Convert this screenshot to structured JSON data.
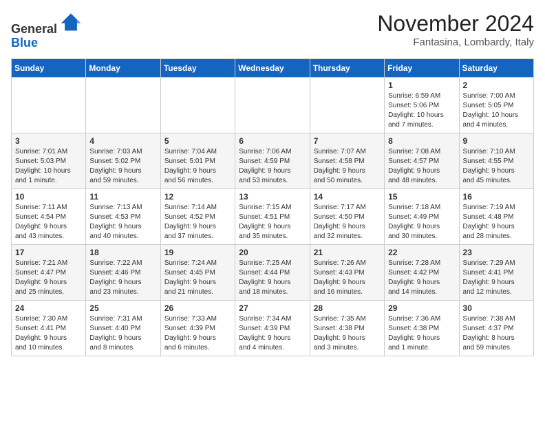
{
  "header": {
    "logo_line1": "General",
    "logo_line2": "Blue",
    "month": "November 2024",
    "location": "Fantasina, Lombardy, Italy"
  },
  "weekdays": [
    "Sunday",
    "Monday",
    "Tuesday",
    "Wednesday",
    "Thursday",
    "Friday",
    "Saturday"
  ],
  "weeks": [
    [
      {
        "day": "",
        "info": ""
      },
      {
        "day": "",
        "info": ""
      },
      {
        "day": "",
        "info": ""
      },
      {
        "day": "",
        "info": ""
      },
      {
        "day": "",
        "info": ""
      },
      {
        "day": "1",
        "info": "Sunrise: 6:59 AM\nSunset: 5:06 PM\nDaylight: 10 hours\nand 7 minutes."
      },
      {
        "day": "2",
        "info": "Sunrise: 7:00 AM\nSunset: 5:05 PM\nDaylight: 10 hours\nand 4 minutes."
      }
    ],
    [
      {
        "day": "3",
        "info": "Sunrise: 7:01 AM\nSunset: 5:03 PM\nDaylight: 10 hours\nand 1 minute."
      },
      {
        "day": "4",
        "info": "Sunrise: 7:03 AM\nSunset: 5:02 PM\nDaylight: 9 hours\nand 59 minutes."
      },
      {
        "day": "5",
        "info": "Sunrise: 7:04 AM\nSunset: 5:01 PM\nDaylight: 9 hours\nand 56 minutes."
      },
      {
        "day": "6",
        "info": "Sunrise: 7:06 AM\nSunset: 4:59 PM\nDaylight: 9 hours\nand 53 minutes."
      },
      {
        "day": "7",
        "info": "Sunrise: 7:07 AM\nSunset: 4:58 PM\nDaylight: 9 hours\nand 50 minutes."
      },
      {
        "day": "8",
        "info": "Sunrise: 7:08 AM\nSunset: 4:57 PM\nDaylight: 9 hours\nand 48 minutes."
      },
      {
        "day": "9",
        "info": "Sunrise: 7:10 AM\nSunset: 4:55 PM\nDaylight: 9 hours\nand 45 minutes."
      }
    ],
    [
      {
        "day": "10",
        "info": "Sunrise: 7:11 AM\nSunset: 4:54 PM\nDaylight: 9 hours\nand 43 minutes."
      },
      {
        "day": "11",
        "info": "Sunrise: 7:13 AM\nSunset: 4:53 PM\nDaylight: 9 hours\nand 40 minutes."
      },
      {
        "day": "12",
        "info": "Sunrise: 7:14 AM\nSunset: 4:52 PM\nDaylight: 9 hours\nand 37 minutes."
      },
      {
        "day": "13",
        "info": "Sunrise: 7:15 AM\nSunset: 4:51 PM\nDaylight: 9 hours\nand 35 minutes."
      },
      {
        "day": "14",
        "info": "Sunrise: 7:17 AM\nSunset: 4:50 PM\nDaylight: 9 hours\nand 32 minutes."
      },
      {
        "day": "15",
        "info": "Sunrise: 7:18 AM\nSunset: 4:49 PM\nDaylight: 9 hours\nand 30 minutes."
      },
      {
        "day": "16",
        "info": "Sunrise: 7:19 AM\nSunset: 4:48 PM\nDaylight: 9 hours\nand 28 minutes."
      }
    ],
    [
      {
        "day": "17",
        "info": "Sunrise: 7:21 AM\nSunset: 4:47 PM\nDaylight: 9 hours\nand 25 minutes."
      },
      {
        "day": "18",
        "info": "Sunrise: 7:22 AM\nSunset: 4:46 PM\nDaylight: 9 hours\nand 23 minutes."
      },
      {
        "day": "19",
        "info": "Sunrise: 7:24 AM\nSunset: 4:45 PM\nDaylight: 9 hours\nand 21 minutes."
      },
      {
        "day": "20",
        "info": "Sunrise: 7:25 AM\nSunset: 4:44 PM\nDaylight: 9 hours\nand 18 minutes."
      },
      {
        "day": "21",
        "info": "Sunrise: 7:26 AM\nSunset: 4:43 PM\nDaylight: 9 hours\nand 16 minutes."
      },
      {
        "day": "22",
        "info": "Sunrise: 7:28 AM\nSunset: 4:42 PM\nDaylight: 9 hours\nand 14 minutes."
      },
      {
        "day": "23",
        "info": "Sunrise: 7:29 AM\nSunset: 4:41 PM\nDaylight: 9 hours\nand 12 minutes."
      }
    ],
    [
      {
        "day": "24",
        "info": "Sunrise: 7:30 AM\nSunset: 4:41 PM\nDaylight: 9 hours\nand 10 minutes."
      },
      {
        "day": "25",
        "info": "Sunrise: 7:31 AM\nSunset: 4:40 PM\nDaylight: 9 hours\nand 8 minutes."
      },
      {
        "day": "26",
        "info": "Sunrise: 7:33 AM\nSunset: 4:39 PM\nDaylight: 9 hours\nand 6 minutes."
      },
      {
        "day": "27",
        "info": "Sunrise: 7:34 AM\nSunset: 4:39 PM\nDaylight: 9 hours\nand 4 minutes."
      },
      {
        "day": "28",
        "info": "Sunrise: 7:35 AM\nSunset: 4:38 PM\nDaylight: 9 hours\nand 3 minutes."
      },
      {
        "day": "29",
        "info": "Sunrise: 7:36 AM\nSunset: 4:38 PM\nDaylight: 9 hours\nand 1 minute."
      },
      {
        "day": "30",
        "info": "Sunrise: 7:38 AM\nSunset: 4:37 PM\nDaylight: 8 hours\nand 59 minutes."
      }
    ]
  ]
}
